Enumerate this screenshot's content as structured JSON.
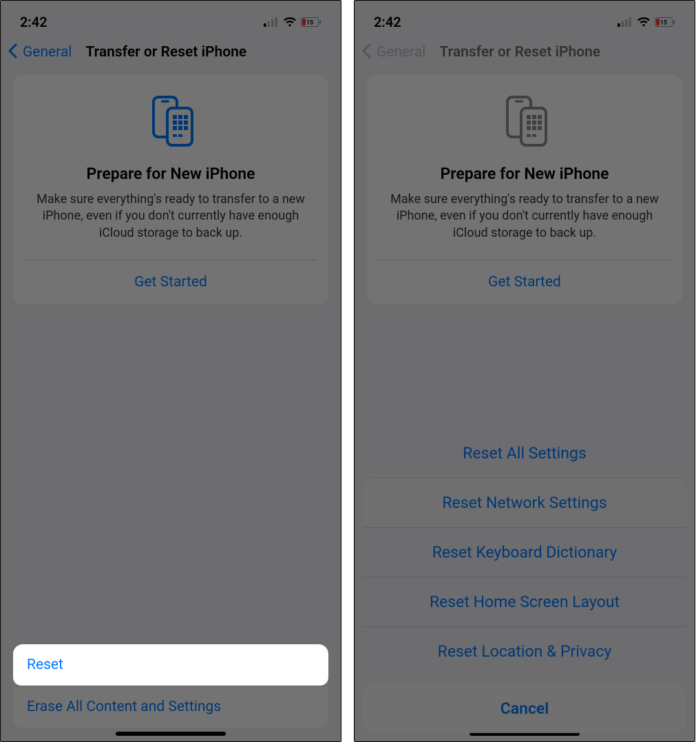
{
  "status": {
    "time": "2:42",
    "battery_pct": "15"
  },
  "nav": {
    "back": "General",
    "title": "Transfer or Reset iPhone"
  },
  "card": {
    "title": "Prepare for New iPhone",
    "desc": "Make sure everything's ready to transfer to a new iPhone, even if you don't currently have enough iCloud storage to back up.",
    "cta": "Get Started"
  },
  "rows": {
    "reset": "Reset",
    "erase": "Erase All Content and Settings"
  },
  "sheet": {
    "all": "Reset All Settings",
    "network": "Reset Network Settings",
    "keyboard": "Reset Keyboard Dictionary",
    "home": "Reset Home Screen Layout",
    "location": "Reset Location & Privacy",
    "cancel": "Cancel"
  }
}
